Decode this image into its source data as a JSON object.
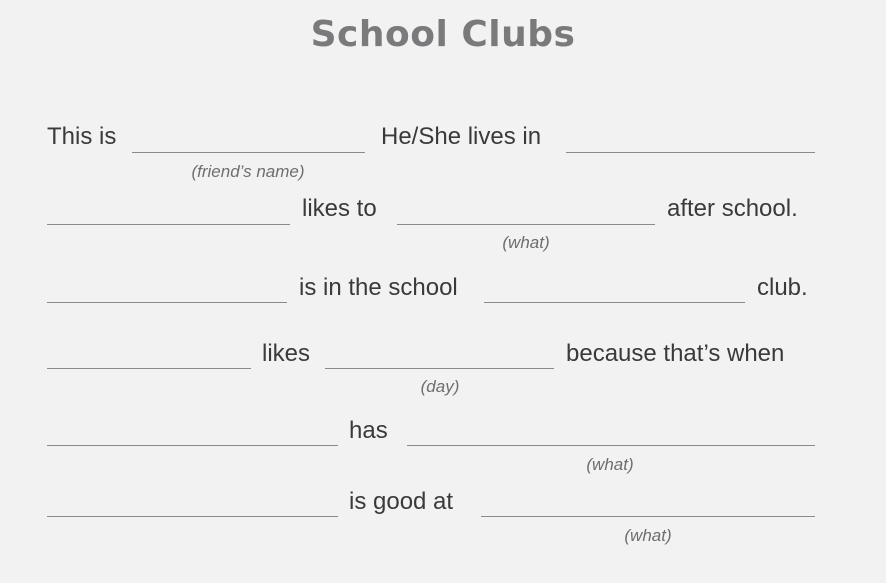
{
  "title": "School Clubs",
  "lines": [
    {
      "texts": [
        "This is",
        "He/She lives in"
      ],
      "hints": [
        "(friend’s name)"
      ]
    },
    {
      "texts": [
        "likes to",
        "after school."
      ],
      "hints": [
        "(what)"
      ]
    },
    {
      "texts": [
        "is in the school",
        "club."
      ],
      "hints": []
    },
    {
      "texts": [
        "likes",
        "because that’s when"
      ],
      "hints": [
        "(day)"
      ]
    },
    {
      "texts": [
        "has"
      ],
      "hints": [
        "(what)"
      ]
    },
    {
      "texts": [
        "is good at"
      ],
      "hints": [
        "(what)"
      ]
    }
  ]
}
